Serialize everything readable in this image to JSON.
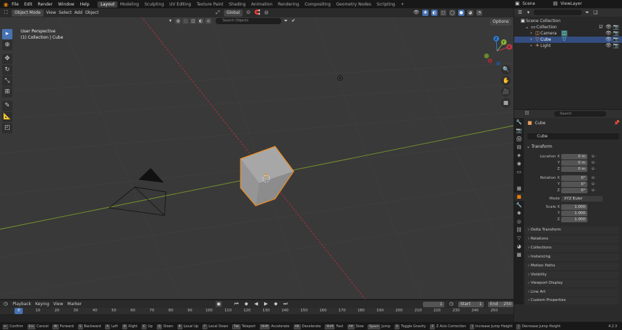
{
  "menu": {
    "file": "File",
    "edit": "Edit",
    "render": "Render",
    "window": "Window",
    "help": "Help"
  },
  "workspaces": [
    "Layout",
    "Modeling",
    "Sculpting",
    "UV Editing",
    "Texture Paint",
    "Shading",
    "Animation",
    "Rendering",
    "Compositing",
    "Geometry Nodes",
    "Scripting"
  ],
  "add_workspace": "+",
  "scene": {
    "name": "Scene",
    "view_layer": "ViewLayer"
  },
  "viewport": {
    "mode": "Object Mode",
    "view": "View",
    "select": "Select",
    "add": "Add",
    "object": "Object",
    "orientation": "Global",
    "search_placeholder": "Search Objects",
    "options": "Options",
    "perspective_label": "User Perspective",
    "collection_label": "(1) Collection | Cube"
  },
  "gizmo": {
    "x": "X",
    "y": "Y",
    "z": "Z"
  },
  "outliner": {
    "search_placeholder": "",
    "root": "Scene Collection",
    "collection": "Collection",
    "items": [
      {
        "name": "Camera"
      },
      {
        "name": "Cube"
      },
      {
        "name": "Light"
      }
    ]
  },
  "properties": {
    "search_placeholder": "Search",
    "object_name": "Cube",
    "data_name": "Cube",
    "transform": "Transform",
    "location_x_label": "Location X",
    "y_label": "Y",
    "z_label": "Z",
    "rotation_x_label": "Rotation X",
    "mode_label": "Mode",
    "scale_x_label": "Scale X",
    "location": [
      "0 m",
      "0 m",
      "0 m"
    ],
    "rotation": [
      "0°",
      "0°",
      "0°"
    ],
    "mode": "XYZ Euler",
    "scale": [
      "1.000",
      "1.000",
      "1.000"
    ],
    "sections": [
      "Delta Transform",
      "Relations",
      "Collections",
      "Instancing",
      "Motion Paths",
      "Visibility",
      "Viewport Display",
      "Line Art",
      "Custom Properties"
    ]
  },
  "timeline": {
    "playback": "Playback",
    "keying": "Keying",
    "view": "View",
    "marker": "Marker",
    "current_frame": "1",
    "start_label": "Start",
    "start": "1",
    "end_label": "End",
    "end": "250",
    "ticks": [
      "0",
      "10",
      "20",
      "30",
      "40",
      "50",
      "60",
      "70",
      "80",
      "90",
      "100",
      "110",
      "120",
      "130",
      "140",
      "150",
      "160",
      "170",
      "180",
      "190",
      "200",
      "210",
      "220",
      "230",
      "240",
      "250"
    ]
  },
  "statusbar": {
    "items": [
      {
        "key": "⇤",
        "label": "Confirm"
      },
      {
        "key": "Esc",
        "label": "Cancel"
      },
      {
        "key": "W",
        "label": "Forward"
      },
      {
        "key": "S",
        "label": "Backward"
      },
      {
        "key": "A",
        "label": "Left"
      },
      {
        "key": "D",
        "label": "Right"
      },
      {
        "key": "E",
        "label": "Up"
      },
      {
        "key": "Q",
        "label": "Down"
      },
      {
        "key": "R",
        "label": "Local Up"
      },
      {
        "key": "F",
        "label": "Local Down"
      },
      {
        "key": "Tab",
        "label": "Teleport"
      },
      {
        "key": "Shift",
        "label": "Accelerate"
      },
      {
        "key": "Alt",
        "label": "Decelerate"
      },
      {
        "key": "Shift",
        "label": "Fast"
      },
      {
        "key": "Alt",
        "label": "Slow"
      },
      {
        "key": "Space",
        "label": "Jump"
      },
      {
        "key": "G",
        "label": "Toggle Gravity"
      },
      {
        "key": "Z",
        "label": "Z Axis Correction"
      },
      {
        "key": "]",
        "label": "Increase Jump Height"
      },
      {
        "key": "[",
        "label": "Decrease Jump Height"
      }
    ],
    "version": "4.2.3"
  },
  "colors": {
    "accent": "#4772b3",
    "orange": "#e87d0d",
    "x_axis": "#c23a46",
    "y_axis": "#8ab33a"
  }
}
